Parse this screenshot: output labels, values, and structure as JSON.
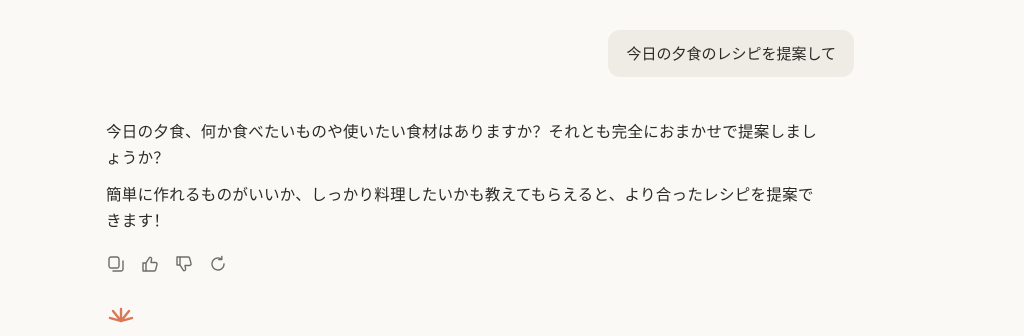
{
  "user_message": {
    "text": "今日の夕食のレシピを提案して"
  },
  "assistant_message": {
    "paragraphs": [
      "今日の夕食、何か食べたいものや使いたい食材はありますか？それとも完全におまかせで提案しましょうか？",
      "簡単に作れるものがいいか、しっかり料理したいかも教えてもらえると、より合ったレシピを提案できます！"
    ]
  },
  "actions": [
    {
      "name": "copy",
      "icon": "copy-icon"
    },
    {
      "name": "thumbs-up",
      "icon": "thumbs-up-icon"
    },
    {
      "name": "thumbs-down",
      "icon": "thumbs-down-icon"
    },
    {
      "name": "retry",
      "icon": "retry-icon"
    }
  ],
  "colors": {
    "background": "#faf9f5",
    "user_bubble": "#efece6",
    "text": "#2b2a27",
    "icon": "#6f6d66",
    "logo_accent": "#d97757"
  }
}
